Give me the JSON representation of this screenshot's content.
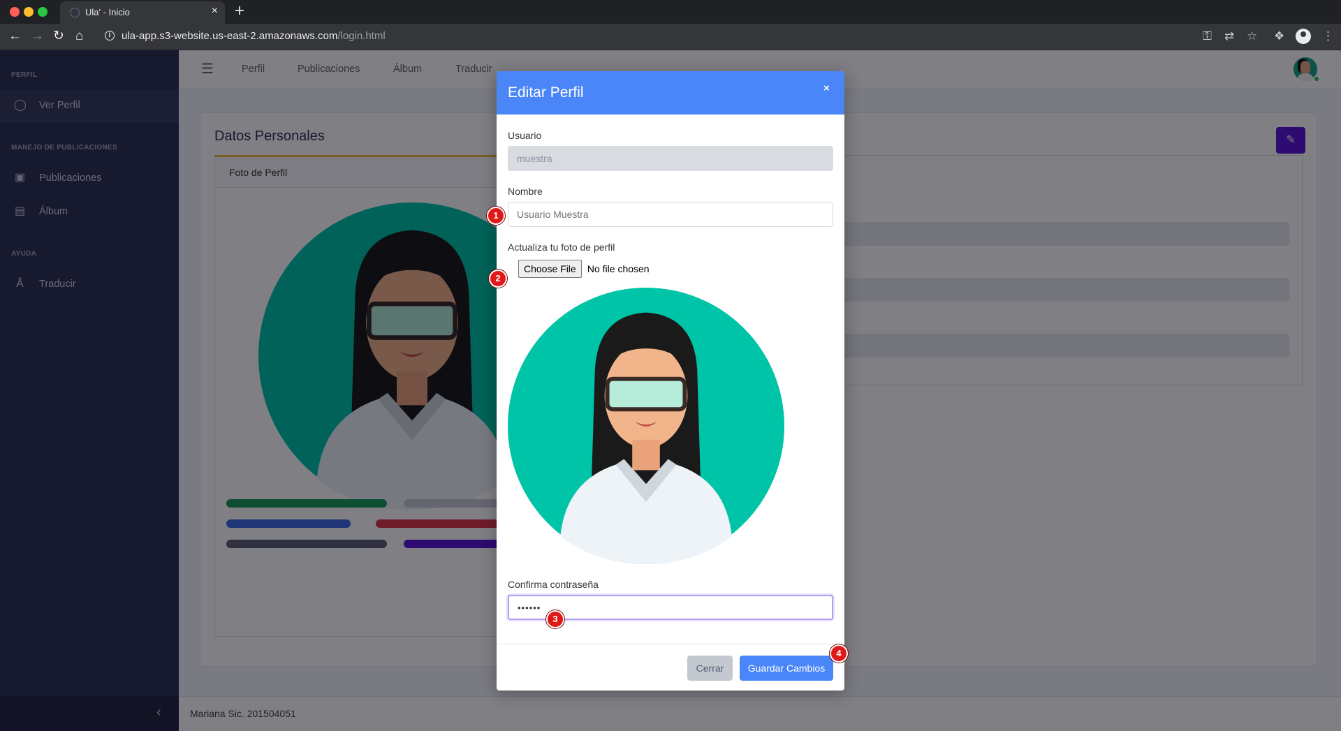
{
  "browser": {
    "tab_title": "Ula' - Inicio",
    "url_domain": "ula-app.s3-website.us-east-2.amazonaws.com",
    "url_path": "/login.html",
    "new_tab_symbol": "+",
    "tab_close_symbol": "×"
  },
  "sidebar": {
    "sections": [
      {
        "heading": "PERFIL",
        "items": [
          {
            "label": "Ver Perfil",
            "icon": "user-icon"
          }
        ]
      },
      {
        "heading": "MANEJO DE PUBLICACIONES",
        "items": [
          {
            "label": "Publicaciones",
            "icon": "camera-icon"
          },
          {
            "label": "Álbum",
            "icon": "book-icon"
          }
        ]
      },
      {
        "heading": "AYUDA",
        "items": [
          {
            "label": "Traducir",
            "icon": "translate-icon"
          }
        ]
      }
    ]
  },
  "topnav": {
    "links": [
      "Perfil",
      "Publicaciones",
      "Álbum",
      "Traducir"
    ]
  },
  "page": {
    "title": "Datos Personales",
    "foto_header": "Foto de Perfil"
  },
  "footer": {
    "text": "Mariana Sic. 201504051"
  },
  "modal": {
    "title": "Editar Perfil",
    "close_symbol": "×",
    "usuario_label": "Usuario",
    "usuario_value": "muestra",
    "nombre_label": "Nombre",
    "nombre_placeholder": "Usuario Muestra",
    "foto_label": "Actualiza tu foto de perfil",
    "file_button": "Choose File",
    "file_status": "No file chosen",
    "confirm_label": "Confirma contraseña",
    "confirm_value": "••••••",
    "cancel_label": "Cerrar",
    "save_label": "Guardar Cambios"
  },
  "markers": [
    "1",
    "2",
    "3",
    "4"
  ],
  "colors": {
    "sidebar": "#2e3353",
    "modal_header": "#4a86f7",
    "primary_button": "#4a86f7",
    "secondary_button": "#c4c9d0",
    "edit_button": "#5a17d6",
    "marker": "#e01818",
    "avatar_bg": "#00c4a7"
  }
}
